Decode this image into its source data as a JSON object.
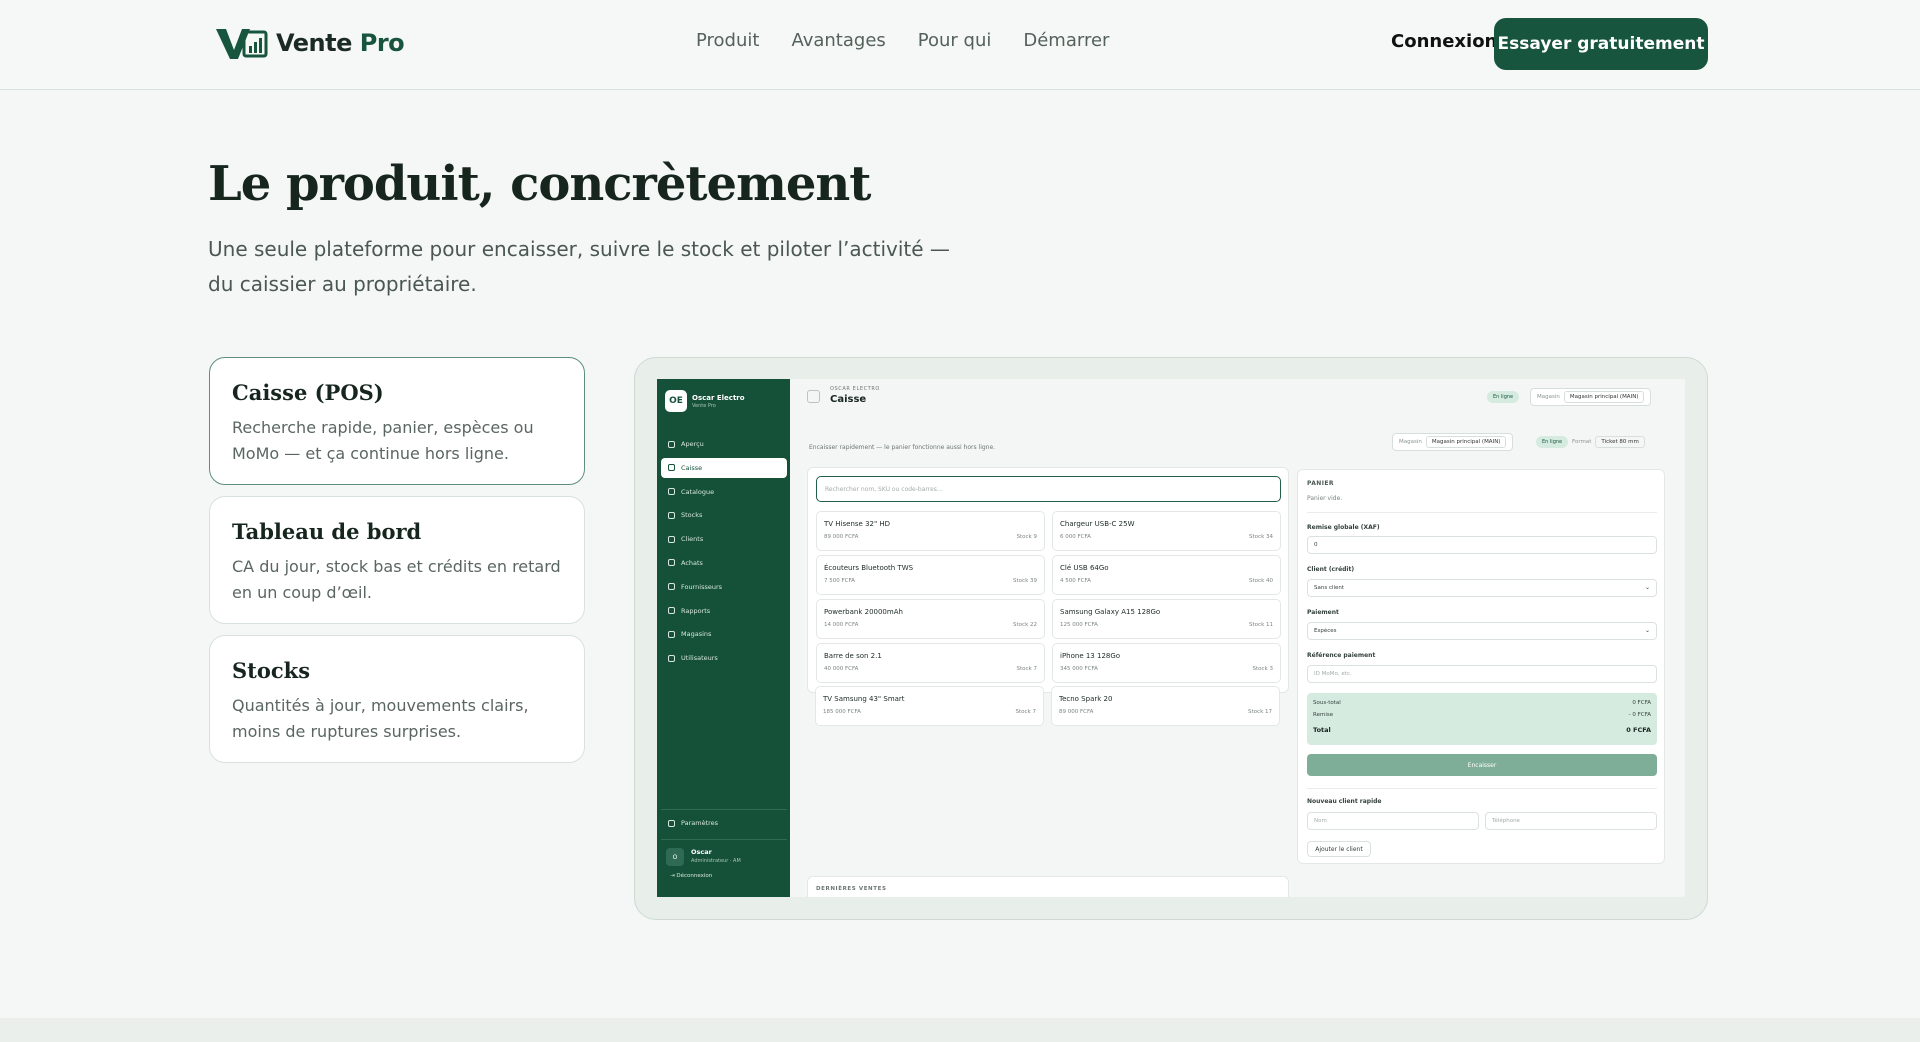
{
  "header": {
    "brand_prefix": "Vente",
    "brand_suffix": "Pro",
    "nav": [
      "Produit",
      "Avantages",
      "Pour qui",
      "Démarrer"
    ],
    "login": "Connexion",
    "cta": "Essayer gratuitement"
  },
  "hero": {
    "title": "Le produit, concrètement",
    "subtitle": "Une seule plateforme pour encaisser, suivre le stock et piloter l’activité — du caissier au propriétaire."
  },
  "features": [
    {
      "title": "Caisse (POS)",
      "desc": "Recherche rapide, panier, espèces ou MoMo — et ça continue hors ligne."
    },
    {
      "title": "Tableau de bord",
      "desc": "CA du jour, stock bas et crédits en retard en un coup d’œil."
    },
    {
      "title": "Stocks",
      "desc": "Quantités à jour, mouvements clairs, moins de ruptures surprises."
    }
  ],
  "app": {
    "logo": "OE",
    "store_name": "Oscar Electro",
    "store_sub": "Vente Pro",
    "nav": [
      "Aperçu",
      "Caisse",
      "Catalogue",
      "Stocks",
      "Clients",
      "Achats",
      "Fournisseurs",
      "Rapports",
      "Magasins",
      "Utilisateurs"
    ],
    "settings": "Paramètres",
    "user_initial": "O",
    "user_name": "Oscar",
    "user_role": "Administrateur · AM",
    "logout": "Déconnexion",
    "brand_caps": "OSCAR ELECTRO",
    "page_title": "Caisse",
    "online": "En ligne",
    "store_label": "Magasin",
    "store_value": "Magasin principal (MAIN)",
    "format_label": "Format",
    "format_value": "Ticket 80 mm",
    "intro": "Encaisser rapidement — le panier fonctionne aussi hors ligne.",
    "search_placeholder": "Rechercher nom, SKU ou code-barres…",
    "products": [
      {
        "name": "TV Hisense 32\" HD",
        "price": "89 000 FCFA",
        "stock": "Stock 9"
      },
      {
        "name": "Chargeur USB-C 25W",
        "price": "6 000 FCFA",
        "stock": "Stock 34"
      },
      {
        "name": "Écouteurs Bluetooth TWS",
        "price": "7 500 FCFA",
        "stock": "Stock 39"
      },
      {
        "name": "Clé USB 64Go",
        "price": "4 500 FCFA",
        "stock": "Stock 40"
      },
      {
        "name": "Powerbank 20000mAh",
        "price": "14 000 FCFA",
        "stock": "Stock 22"
      },
      {
        "name": "Samsung Galaxy A15 128Go",
        "price": "125 000 FCFA",
        "stock": "Stock 11"
      },
      {
        "name": "Barre de son 2.1",
        "price": "40 000 FCFA",
        "stock": "Stock 7"
      },
      {
        "name": "iPhone 13 128Go",
        "price": "345 000 FCFA",
        "stock": "Stock 3"
      },
      {
        "name": "TV Samsung 43\" Smart",
        "price": "185 000 FCFA",
        "stock": "Stock 7"
      },
      {
        "name": "Tecno Spark 20",
        "price": "89 000 FCFA",
        "stock": "Stock 17"
      }
    ],
    "cart": {
      "heading": "PANIER",
      "empty": "Panier vide.",
      "discount_label": "Remise globale (XAF)",
      "discount_value": "0",
      "client_label": "Client (crédit)",
      "client_value": "Sans client",
      "payment_label": "Paiement",
      "payment_value": "Espèces",
      "ref_label": "Référence paiement",
      "ref_placeholder": "ID MoMo, etc.",
      "subtotal_label": "Sous-total",
      "subtotal_value": "0 FCFA",
      "discount_row_label": "Remise",
      "discount_row_value": "- 0 FCFA",
      "total_label": "Total",
      "total_value": "0 FCFA",
      "checkout": "Encaisser",
      "quick_client": "Nouveau client rapide",
      "name_placeholder": "Nom",
      "phone_placeholder": "Téléphone",
      "add_client": "Ajouter le client"
    },
    "recent_sales": "DERNIÈRES VENTES"
  }
}
